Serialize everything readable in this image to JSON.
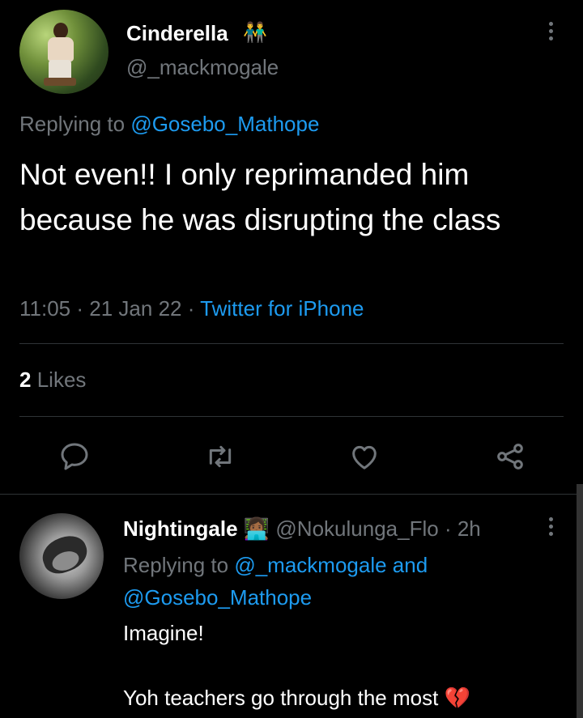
{
  "main_tweet": {
    "display_name": "Cinderella",
    "name_emoji": "👬",
    "handle": "@_mackmogale",
    "replying_prefix": "Replying to",
    "replying_handle": "@Gosebo_Mathope",
    "text": "Not even!! I only reprimanded him because he was disrupting the class",
    "time": "11:05",
    "date": "21 Jan 22",
    "source": "Twitter for iPhone",
    "likes_count": "2",
    "likes_label": "Likes"
  },
  "actions": {
    "reply_icon": "reply-icon",
    "retweet_icon": "retweet-icon",
    "like_icon": "heart-icon",
    "share_icon": "share-icon"
  },
  "reply_tweet": {
    "display_name": "Nightingale",
    "name_emoji": "👩🏾‍💻",
    "handle": "@Nokulunga_Flo",
    "time_ago": "2h",
    "replying_prefix": "Replying to",
    "replying_handle_1": "@_mackmogale",
    "replying_and": "and",
    "replying_handle_2": "@Gosebo_Mathope",
    "line1": "Imagine!",
    "line2": "Yoh teachers go through the most",
    "line2_emoji": "💔"
  },
  "colors": {
    "background": "#000000",
    "text": "#e7e9ea",
    "muted": "#71767b",
    "link": "#1d9bf0",
    "divider": "#2f3336"
  }
}
